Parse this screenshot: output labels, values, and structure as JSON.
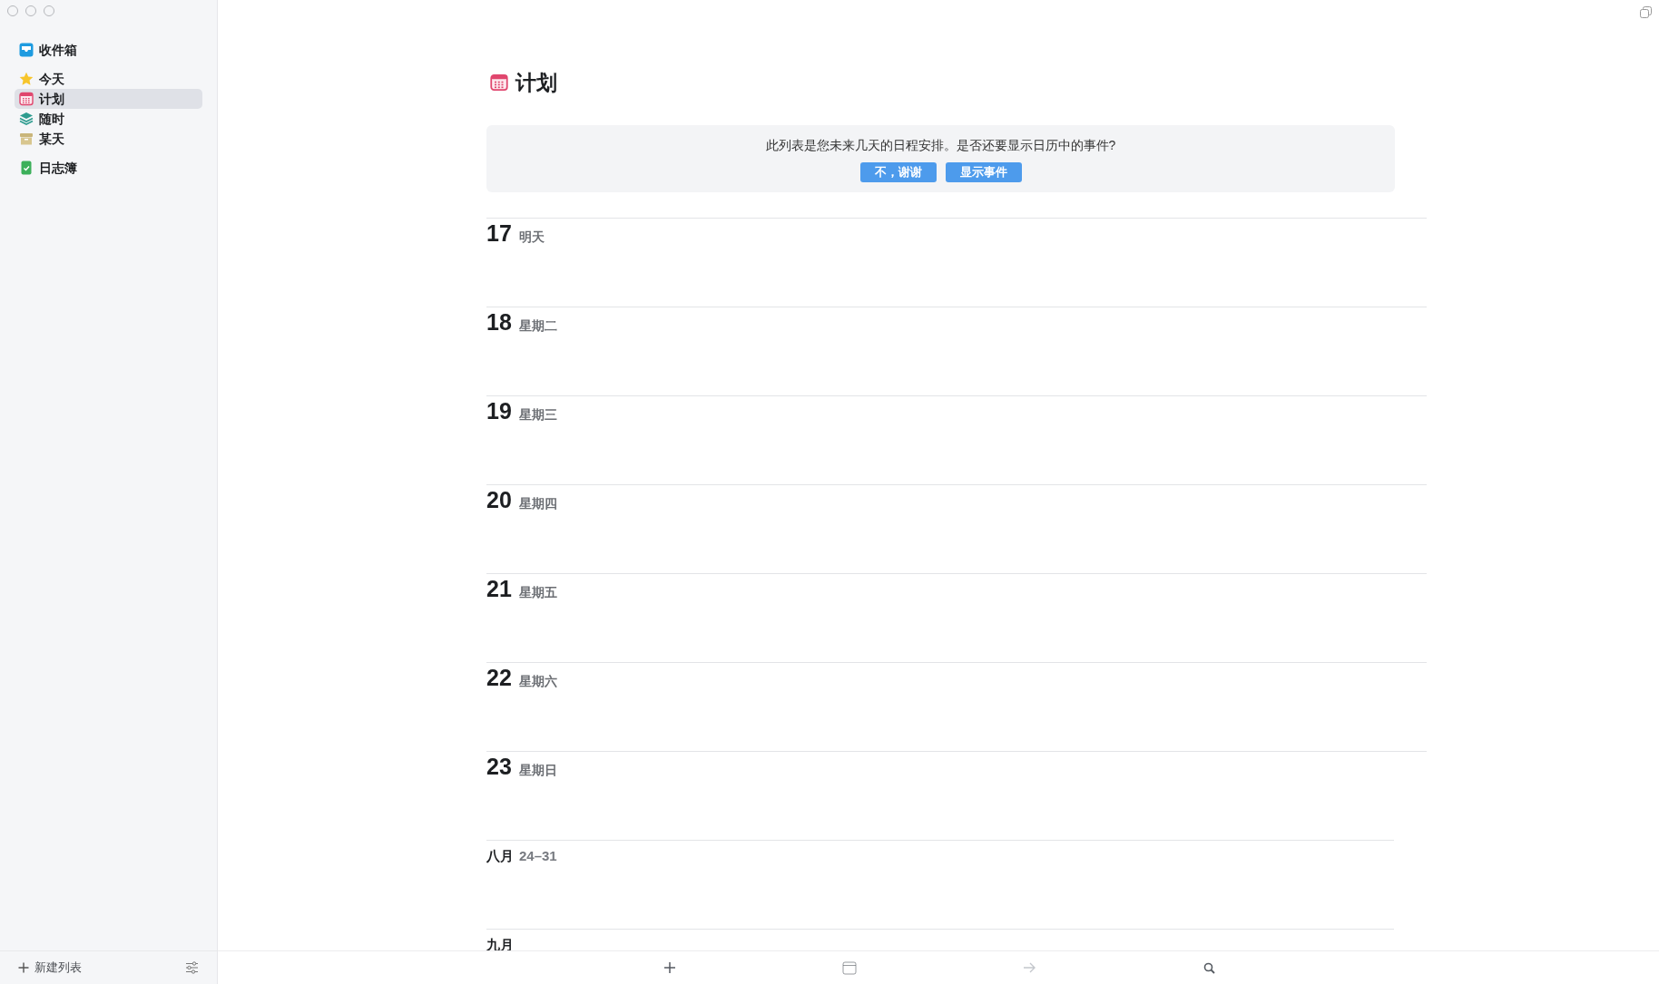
{
  "sidebar": {
    "groups": [
      [
        {
          "label": "收件箱",
          "kind": "inbox",
          "selected": false
        }
      ],
      [
        {
          "label": "今天",
          "kind": "today",
          "selected": false
        },
        {
          "label": "计划",
          "kind": "upcoming",
          "selected": true
        },
        {
          "label": "随时",
          "kind": "anytime",
          "selected": false
        },
        {
          "label": "某天",
          "kind": "someday",
          "selected": false
        }
      ],
      [
        {
          "label": "日志簿",
          "kind": "logbook",
          "selected": false
        }
      ]
    ],
    "new_list": "新建列表"
  },
  "main": {
    "title": "计划",
    "banner": {
      "message": "此列表是您未来几天的日程安排。是否还要显示日历中的事件?",
      "buttons": [
        "不，谢谢",
        "显示事件"
      ]
    },
    "sections": [
      {
        "kind": "day",
        "number": "17",
        "label": "明天"
      },
      {
        "kind": "day",
        "number": "18",
        "label": "星期二"
      },
      {
        "kind": "day",
        "number": "19",
        "label": "星期三"
      },
      {
        "kind": "day",
        "number": "20",
        "label": "星期四"
      },
      {
        "kind": "day",
        "number": "21",
        "label": "星期五"
      },
      {
        "kind": "day",
        "number": "22",
        "label": "星期六"
      },
      {
        "kind": "day",
        "number": "23",
        "label": "星期日"
      },
      {
        "kind": "month",
        "label": "八月",
        "range": "24–31"
      },
      {
        "kind": "month",
        "label": "九月"
      }
    ]
  },
  "toolbar": [
    {
      "kind": "add",
      "disabled": false
    },
    {
      "kind": "calendar",
      "disabled": false
    },
    {
      "kind": "move",
      "disabled": true
    },
    {
      "kind": "search",
      "disabled": false
    }
  ]
}
